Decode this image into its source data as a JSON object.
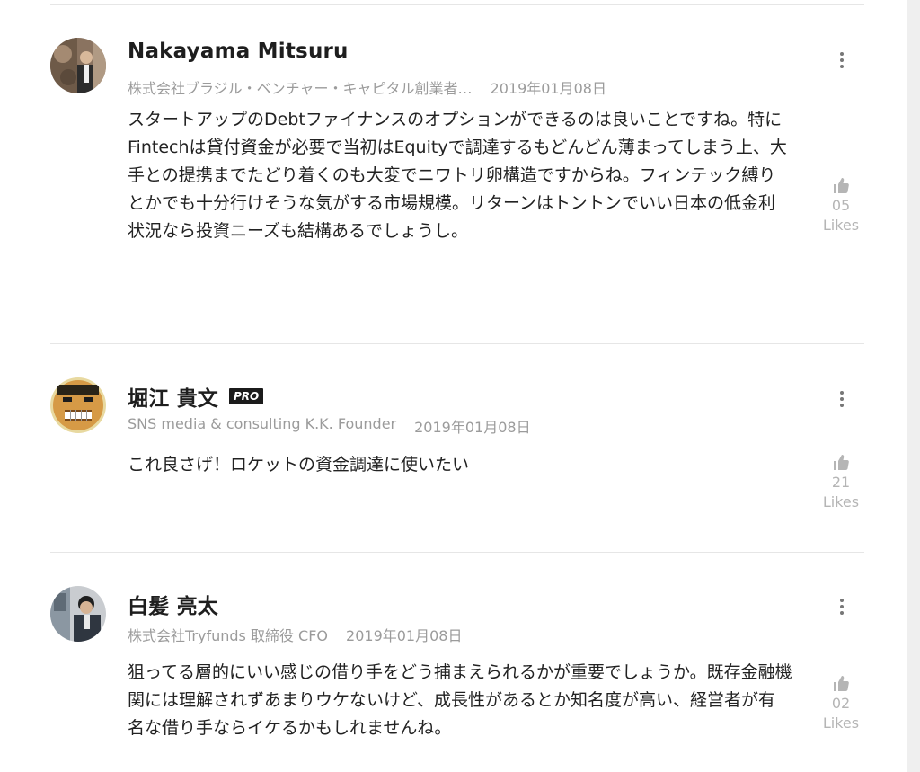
{
  "comments": [
    {
      "name": "Nakayama Mitsuru",
      "pro": false,
      "affiliation": "株式会社ブラジル・ベンチャー・キャピタル創業者…",
      "date": "2019年01月08日",
      "body": "スタートアップのDebtファイナンスのオプションができるのは良いことですね。特にFintechは貸付資金が必要で当初はEquityで調達するもどんどん薄まってしまう上、大手との提携までたどり着くのも大変でニワトリ卵構造ですからね。フィンテック縛りとかでも十分行けそうな気がする市場規模。リターンはトントンでいい日本の低金利状況なら投資ニーズも結構あるでしょうし。",
      "likes_count": "05",
      "likes_label": "Likes"
    },
    {
      "name": "堀江 貴文",
      "pro": true,
      "pro_label": "PRO",
      "affiliation": "SNS media & consulting K.K. Founder",
      "date": "2019年01月08日",
      "body": "これ良さげ！ロケットの資金調達に使いたい",
      "likes_count": "21",
      "likes_label": "Likes"
    },
    {
      "name": "白髪 亮太",
      "pro": false,
      "affiliation": "株式会社Tryfunds 取締役 CFO",
      "date": "2019年01月08日",
      "body": "狙ってる層的にいい感じの借り手をどう捕まえられるかが重要でしょうか。既存金融機関には理解されずあまりウケないけど、成長性があるとか知名度が高い、経営者が有名な借り手ならイケるかもしれませんね。",
      "likes_count": "02",
      "likes_label": "Likes"
    }
  ],
  "icons": {
    "more": "more-vertical-icon",
    "like": "thumbs-up-icon"
  },
  "colors": {
    "text": "#222222",
    "meta": "#9b9b9b",
    "likes": "#b5b5b5",
    "badge": "#1b1b1b"
  }
}
